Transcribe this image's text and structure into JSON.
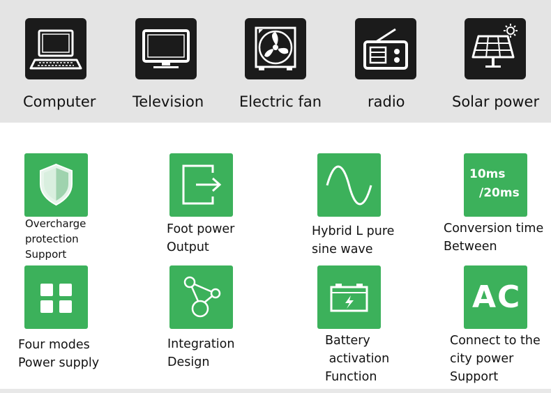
{
  "appliances": [
    {
      "label": "Computer",
      "icon": "laptop-icon"
    },
    {
      "label": "Television",
      "icon": "television-icon"
    },
    {
      "label": "Electric fan",
      "icon": "fan-icon"
    },
    {
      "label": "radio",
      "icon": "radio-icon"
    },
    {
      "label": "Solar power",
      "icon": "solar-panel-icon"
    }
  ],
  "features": [
    {
      "icon": "shield-icon",
      "lines": [
        "Overcharge",
        "protection",
        "Support"
      ]
    },
    {
      "icon": "exit-arrow-icon",
      "lines": [
        "Foot power",
        "Output"
      ]
    },
    {
      "icon": "sine-wave-icon",
      "lines": [
        "Hybrid L pure",
        "sine wave"
      ]
    },
    {
      "icon": "timer-text-icon",
      "icon_text": [
        "10ms",
        "/20ms"
      ],
      "lines": [
        "Conversion time",
        "Between"
      ]
    },
    {
      "icon": "four-squares-icon",
      "lines": [
        "Four modes",
        "Power supply"
      ]
    },
    {
      "icon": "network-nodes-icon",
      "lines": [
        "Integration",
        "Design"
      ]
    },
    {
      "icon": "battery-icon",
      "lines": [
        "Battery",
        " activation",
        "Function"
      ]
    },
    {
      "icon": "ac-text-icon",
      "icon_text": [
        "AC"
      ],
      "lines": [
        "Connect to the",
        "city power",
        "Support"
      ]
    }
  ],
  "colors": {
    "feature_green": "#3cb15b",
    "appliance_icon_bg": "#1b1b1b",
    "top_band_bg": "#e4e4e4"
  }
}
